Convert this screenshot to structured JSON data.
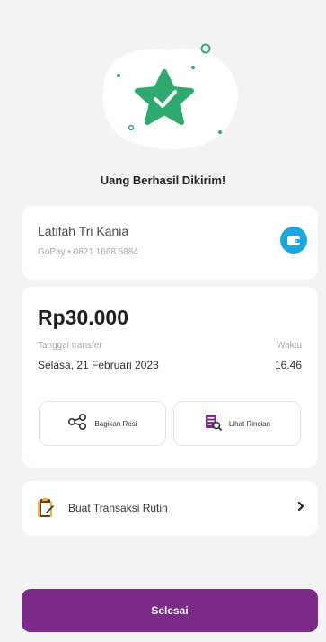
{
  "status": {
    "title": "Uang Berhasil Dikirim!"
  },
  "recipient": {
    "name": "Latifah Tri Kania",
    "detail": "GoPay • 0821 1668 5884",
    "badge_icon": "wallet-icon"
  },
  "transfer": {
    "amount": "Rp30.000",
    "date_label": "Tanggal transfer",
    "date_value": "Selasa, 21 Februari 2023",
    "time_label": "Waktu",
    "time_value": "16.46"
  },
  "actions": {
    "share_label": "Bagikan Resi",
    "detail_label": "Lihat Rincian"
  },
  "routine": {
    "label": "Buat Transaksi Rutin"
  },
  "footer": {
    "done_label": "Selesai"
  },
  "colors": {
    "brand_purple": "#7b2a87",
    "success_green": "#2eaa6e",
    "wallet_blue": "#19a7e0",
    "background": "#f3f3f5"
  }
}
